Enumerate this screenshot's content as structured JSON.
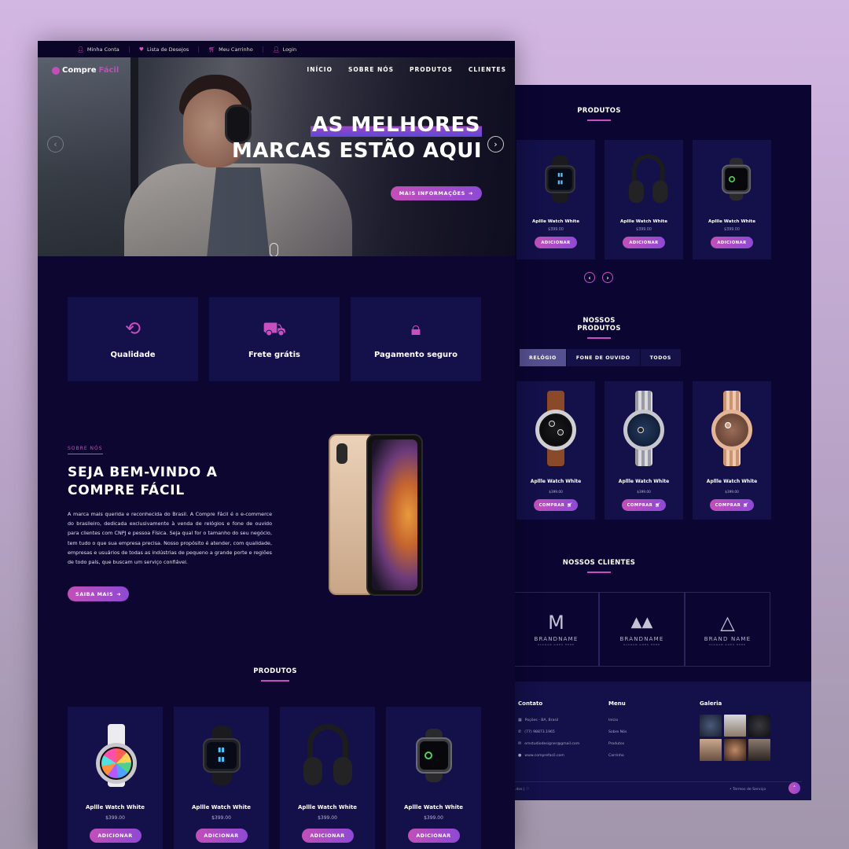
{
  "topbar": {
    "account": "Minha Conta",
    "wishlist": "Lista de Desejos",
    "cart": "Meu Carrinho",
    "login": "Login"
  },
  "brand": {
    "part1": "Compre",
    "part2": "Fácil",
    "accent": "#c94fc0",
    "bg": "#0d0630"
  },
  "nav": [
    "INÍCIO",
    "SOBRE NÓS",
    "PRODUTOS",
    "CLIENTES"
  ],
  "hero": {
    "line1": "AS MELHORES",
    "line2": "MARCAS ESTÃO AQUI",
    "button": "MAIS INFORMAÇÕES",
    "prev_icon": "chevron-left-icon",
    "next_icon": "chevron-right-icon"
  },
  "features": [
    {
      "label": "Qualidade",
      "icon": "sync-icon"
    },
    {
      "label": "Frete grátis",
      "icon": "truck-icon"
    },
    {
      "label": "Pagamento seguro",
      "icon": "lock-icon"
    }
  ],
  "about": {
    "kicker": "SOBRE NÓS",
    "title_line1": "SEJA BEM-VINDO A",
    "title_line2": "COMPRE FÁCIL",
    "text": "A marca mais querida e reconhecida do Brasil. A Compre Fácil é o e-commerce do brasileiro, dedicada exclusivamente à venda de relógios e fone de ouvido para clientes com CNPJ e pessoa Física. Seja qual for o tamanho do seu negócio, tem tudo o que sua empresa precisa. Nosso propósito é atender, com qualidade, empresas e usuários de todas as indústrias de pequeno a grande porte e regiões de todo país, que buscam um serviço confiável.",
    "button": "SAIBA MAIS"
  },
  "products_left": {
    "title": "PRODUTOS",
    "items": [
      {
        "name": "Apllle Watch White",
        "price": "$399.00",
        "button": "ADICIONAR"
      },
      {
        "name": "Apllle Watch White",
        "price": "$399.00",
        "button": "ADICIONAR"
      },
      {
        "name": "Apllle Watch White",
        "price": "$399.00",
        "button": "ADICIONAR"
      },
      {
        "name": "Apllle Watch White",
        "price": "$399.00",
        "button": "ADICIONAR"
      }
    ]
  },
  "products_right": {
    "title": "PRODUTOS",
    "items": [
      {
        "name": "Apllle Watch White",
        "price": "$399.00",
        "button": "ADICIONAR"
      },
      {
        "name": "Apllle Watch White",
        "price": "$399.00",
        "button": "ADICIONAR"
      },
      {
        "name": "Apllle Watch White",
        "price": "$399.00",
        "button": "ADICIONAR"
      }
    ]
  },
  "our_products": {
    "title": "NOSSOS PRODUTOS",
    "tabs": [
      "RELÓGIO",
      "FONE DE OUVIDO",
      "TODOS"
    ],
    "active_tab": "RELÓGIO",
    "items": [
      {
        "name": "Apllle Watch White",
        "price": "$399.00",
        "button": "COMPRAR"
      },
      {
        "name": "Apllle Watch White",
        "price": "$399.00",
        "button": "COMPRAR"
      },
      {
        "name": "Apllle Watch White",
        "price": "$399.00",
        "button": "COMPRAR"
      }
    ]
  },
  "clients": {
    "title": "NOSSOS CLIENTES",
    "items": [
      {
        "mark": "M",
        "name": "BRANDNAME",
        "slogan": "SLOGAN GOES HERE"
      },
      {
        "mark": "▲▲",
        "name": "BRANDNAME",
        "slogan": "SLOGAN GOES HERE"
      },
      {
        "mark": "△",
        "name": "BRAND NAME",
        "slogan": "SLOGAN GOES HERE"
      }
    ]
  },
  "footer": {
    "contact_title": "Contato",
    "contact": [
      "Poções - BA, Brasil",
      "(77) 98873.1965",
      "emstudiodesigner@gmail.com",
      "www.comprefacil.com"
    ],
    "menu_title": "Menu",
    "menu": [
      "Início",
      "Sobre Nós",
      "Produtos",
      "Carrinho"
    ],
    "gallery_title": "Galeria",
    "copyright": "...dos | ♡",
    "terms": "• Termos de Serviço"
  }
}
